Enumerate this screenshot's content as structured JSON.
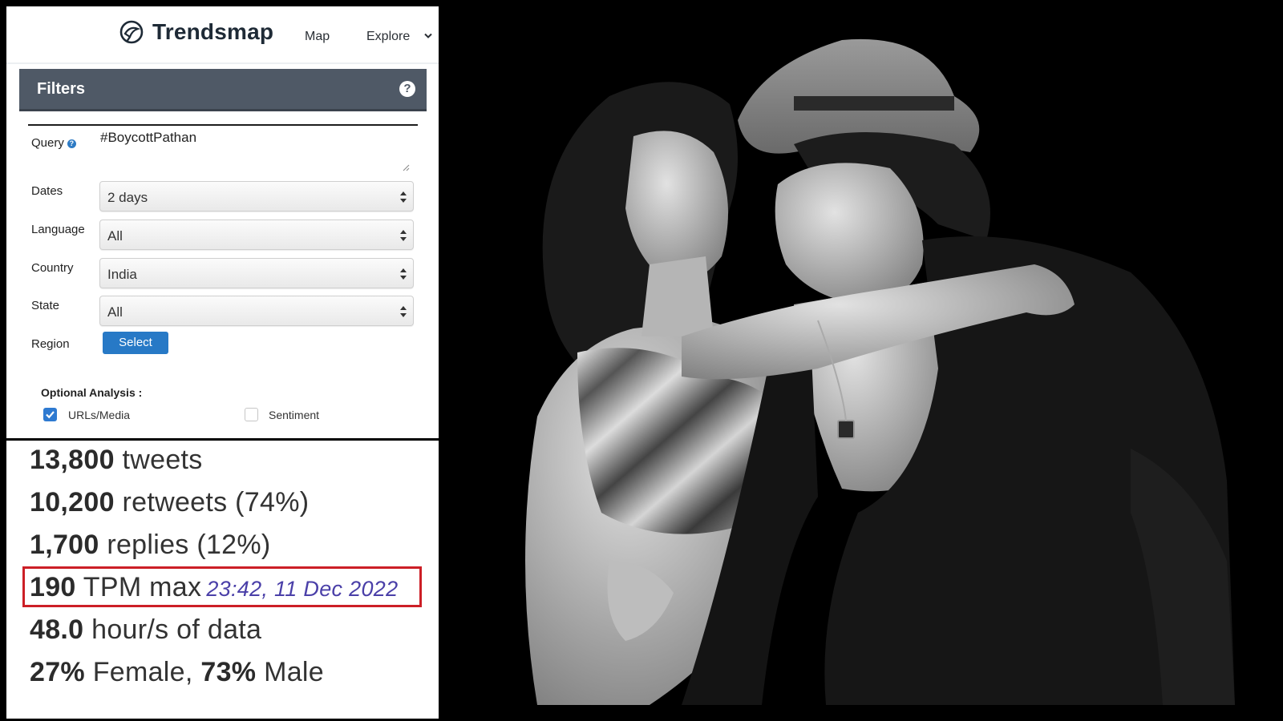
{
  "app": {
    "brand": "Trendsmap",
    "nav": {
      "map": "Map",
      "explore": "Explore"
    }
  },
  "filters": {
    "title": "Filters",
    "help": "?",
    "query": {
      "label": "Query",
      "value": "#BoycottPathan"
    },
    "dates": {
      "label": "Dates",
      "value": "2 days"
    },
    "language": {
      "label": "Language",
      "value": "All"
    },
    "country": {
      "label": "Country",
      "value": "India"
    },
    "state": {
      "label": "State",
      "value": "All"
    },
    "region": {
      "label": "Region",
      "button": "Select"
    },
    "optional_analysis": {
      "title": "Optional Analysis :",
      "options": [
        {
          "label": "URLs/Media",
          "checked": true
        },
        {
          "label": "Sentiment",
          "checked": false
        }
      ]
    }
  },
  "stats": {
    "tweets": {
      "value": "13,800",
      "text": " tweets"
    },
    "retweets": {
      "value": "10,200",
      "text": " retweets (74%)"
    },
    "replies": {
      "value": "1,700",
      "text": " replies (12%)"
    },
    "tpm": {
      "value": "190",
      "text": " TPM max",
      "timestamp": "23:42, 11 Dec 2022"
    },
    "hours": {
      "value": "48.0",
      "text": " hour/s of data"
    },
    "gender": {
      "female_value": "27%",
      "female_text": " Female, ",
      "male_value": "73%",
      "male_text": " Male"
    }
  },
  "colors": {
    "filters_bar": "#4f5966",
    "select_button": "#2779c6",
    "highlight_border": "#cc1f26",
    "timestamp": "#4a3fa8"
  },
  "icons": [
    "trendsmap-logo-icon",
    "chevron-down-icon",
    "help-icon",
    "resize-grip-icon",
    "select-arrows-icon",
    "checkbox-checked-icon",
    "checkbox-empty-icon"
  ]
}
